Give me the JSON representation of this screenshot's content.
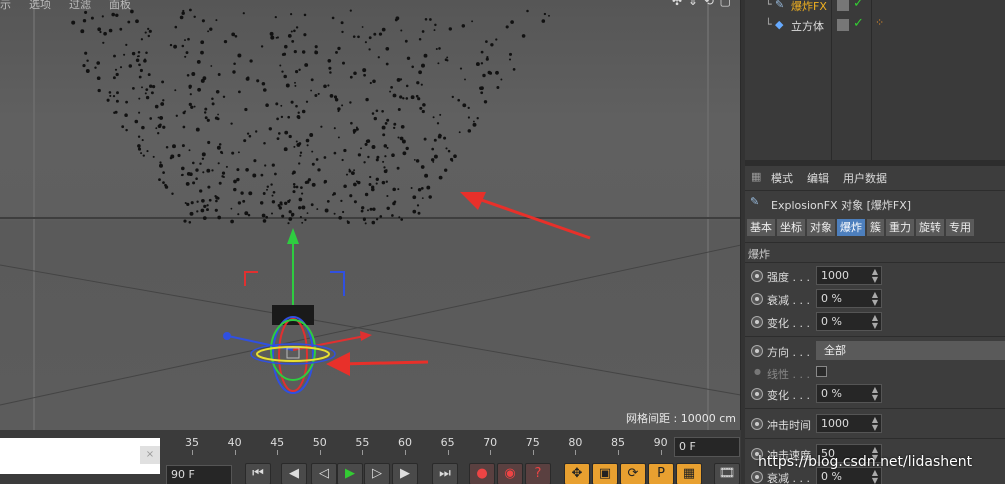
{
  "viewport": {
    "menu": [
      "示",
      "选项",
      "过滤",
      "面板"
    ],
    "grid_label": "网格间距 : 10000 cm",
    "nav_icons": "✣ ⇕ ⟲ ▢"
  },
  "timeline": {
    "ticks": [
      "35",
      "40",
      "45",
      "50",
      "55",
      "60",
      "65",
      "70",
      "75",
      "80",
      "85",
      "90"
    ],
    "current_frame": "0 F",
    "end_frame": "90 F",
    "box_glyph": "×",
    "buttons": [
      {
        "name": "goto-start-button",
        "glyph": "⏮"
      },
      {
        "name": "prev-key-button",
        "glyph": "◀"
      },
      {
        "name": "prev-frame-button",
        "glyph": "◁"
      },
      {
        "name": "play-button",
        "glyph": "▶"
      },
      {
        "name": "next-frame-button",
        "glyph": "▷"
      },
      {
        "name": "next-key-button",
        "glyph": "▶"
      },
      {
        "name": "goto-end-button",
        "glyph": "⏭"
      },
      {
        "name": "record-button",
        "glyph": "●"
      },
      {
        "name": "autokey-button",
        "glyph": "◉"
      },
      {
        "name": "keyframe-help-button",
        "glyph": "?"
      },
      {
        "name": "move-key-button",
        "glyph": "✥"
      },
      {
        "name": "scale-key-button",
        "glyph": "▣"
      },
      {
        "name": "rotate-key-button",
        "glyph": "⟳"
      },
      {
        "name": "param-key-button",
        "glyph": "P"
      },
      {
        "name": "pla-key-button",
        "glyph": "▦"
      },
      {
        "name": "film-button",
        "glyph": "🎞"
      }
    ]
  },
  "objects": [
    {
      "name": "爆炸FX",
      "color": "#f0b020"
    },
    {
      "name": "立方体",
      "color": "#dddddd"
    }
  ],
  "attr": {
    "menu": [
      "模式",
      "编辑",
      "用户数据"
    ],
    "title": "ExplosionFX 对象 [爆炸FX]",
    "tabs": [
      "基本",
      "坐标",
      "对象",
      "爆炸",
      "簇",
      "重力",
      "旋转",
      "专用"
    ],
    "active_tab": "爆炸",
    "section": "爆炸",
    "params": {
      "strength": {
        "label": "强度 . . .",
        "value": "1000"
      },
      "decay": {
        "label": "衰减 . . .",
        "value": "0 %"
      },
      "variation": {
        "label": "变化 . . .",
        "value": "0 %"
      },
      "direction": {
        "label": "方向 . . .",
        "value": "全部"
      },
      "linear": {
        "label": "线性 . . ."
      },
      "variation2": {
        "label": "变化 . . .",
        "value": "0 %"
      },
      "impact_time": {
        "label": "冲击时间",
        "value": "1000"
      },
      "impact_speed": {
        "label": "冲击速度",
        "value": "50"
      },
      "decay2": {
        "label": "衰减 . . .",
        "value": "0 %"
      }
    }
  },
  "watermark": "https://blog.csdn.net/lidashent",
  "colors": {
    "accent": "#4d7fbd",
    "object_yellow": "#f0b020",
    "arrow_red": "#e8302a"
  }
}
